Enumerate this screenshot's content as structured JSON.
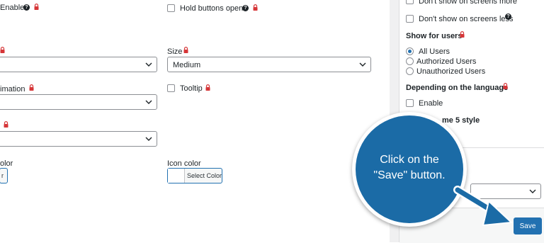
{
  "main": {
    "enable_label": "Enable",
    "hold_buttons_open_label": "Hold buttons open",
    "size_label": "Size",
    "size_value": "Medium",
    "animation_label": "imation",
    "tooltip_label": "Tooltip",
    "color_label": "olor",
    "color_button": "r",
    "icon_color_label": "Icon color",
    "icon_color_button": "Select Color"
  },
  "sidebar": {
    "dont_show_more": "Don't show on screens more",
    "dont_show_less": "Don't show on screens less",
    "show_for_users_heading": "Show for users",
    "users_options": [
      "All Users",
      "Authorized Users",
      "Unauthorized Users"
    ],
    "users_selected": "All Users",
    "language_heading": "Depending on the language",
    "language_enable": "Enable",
    "style_partial": "me 5 style",
    "save_label": "Save"
  },
  "callout": {
    "line1": "Click on the",
    "line2": "\"Save\" button."
  },
  "colors": {
    "accent": "#2271b1",
    "callout_fill": "#1b6ba6",
    "lock_red": "#d63638",
    "arrow": "#1b6ba6"
  }
}
